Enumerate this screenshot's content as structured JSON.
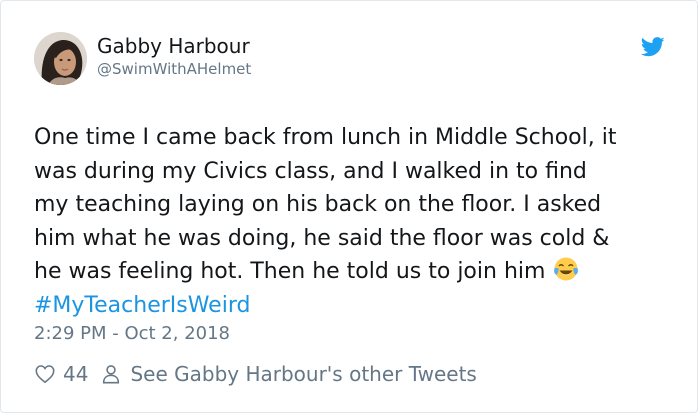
{
  "tweet": {
    "author_name": "Gabby Harbour",
    "author_handle": "@SwimWithAHelmet",
    "text_lines": [
      "One time I came back from lunch in Middle School, it",
      "was during my Civics class, and I walked in to find",
      "my teaching laying on his back on the floor. I asked",
      "him what he was doing, he said the floor was cold &",
      "he was feeling hot. Then he told us to join him"
    ],
    "emoji": "face-with-tears-of-joy",
    "hashtag": "#MyTeacherIsWeird",
    "timestamp": "2:29 PM - Oct 2, 2018",
    "like_count": "44",
    "see_more_label": "See Gabby Harbour's other Tweets"
  },
  "colors": {
    "link": "#1b95e0",
    "secondary_text": "#657786",
    "primary_text": "#14171a",
    "twitter_blue": "#1da1f2",
    "border": "#e1e8ed"
  },
  "icons": {
    "brand": "twitter-bird-icon",
    "like": "heart-icon",
    "profile": "person-icon"
  }
}
